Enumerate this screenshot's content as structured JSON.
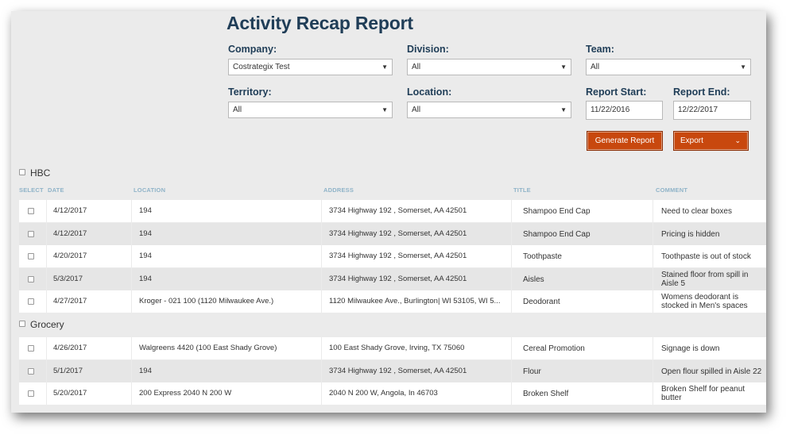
{
  "title": "Activity Recap Report",
  "filters": {
    "company": {
      "label": "Company:",
      "value": "Costrategix Test"
    },
    "division": {
      "label": "Division:",
      "value": "All"
    },
    "team": {
      "label": "Team:",
      "value": "All"
    },
    "territory": {
      "label": "Territory:",
      "value": "All"
    },
    "location": {
      "label": "Location:",
      "value": "All"
    },
    "report_start": {
      "label": "Report Start:",
      "value": "11/22/2016"
    },
    "report_end": {
      "label": "Report End:",
      "value": "12/22/2017"
    }
  },
  "buttons": {
    "generate": "Generate Report",
    "export": "Export"
  },
  "columns": {
    "select": "SELECT",
    "date": "DATE",
    "location": "LOCATION",
    "address": "ADDRESS",
    "title": "TITLE",
    "comment": "COMMENT"
  },
  "groups": [
    {
      "name": "HBC",
      "rows": [
        {
          "date": "4/12/2017",
          "location": "194",
          "address": "3734 Highway 192 , Somerset, AA 42501",
          "title": "Shampoo End Cap",
          "comment": "Need to clear boxes"
        },
        {
          "date": "4/12/2017",
          "location": "194",
          "address": "3734 Highway 192 , Somerset, AA 42501",
          "title": "Shampoo End Cap",
          "comment": "Pricing is hidden"
        },
        {
          "date": "4/20/2017",
          "location": "194",
          "address": "3734 Highway 192 , Somerset, AA 42501",
          "title": "Toothpaste",
          "comment": "Toothpaste is out of stock"
        },
        {
          "date": "5/3/2017",
          "location": "194",
          "address": "3734 Highway 192 , Somerset, AA 42501",
          "title": "Aisles",
          "comment": "Stained floor from spill in Aisle 5"
        },
        {
          "date": "4/27/2017",
          "location": "Kroger - 021 100 (1120 Milwaukee Ave.)",
          "address": "1120 Milwaukee Ave., Burlington| WI 53105, WI 5...",
          "title": "Deodorant",
          "comment": "Womens deodorant is stocked in Men's spaces"
        }
      ]
    },
    {
      "name": "Grocery",
      "rows": [
        {
          "date": "4/26/2017",
          "location": "Walgreens 4420 (100 East Shady Grove)",
          "address": "100 East Shady Grove, Irving, TX 75060",
          "title": "Cereal Promotion",
          "comment": "Signage is down"
        },
        {
          "date": "5/1/2017",
          "location": "194",
          "address": "3734 Highway 192 , Somerset, AA 42501",
          "title": "Flour",
          "comment": "Open flour spilled in Aisle 22"
        },
        {
          "date": "5/20/2017",
          "location": "200 Express 2040 N 200 W",
          "address": "2040 N 200 W, Angola, In 46703",
          "title": "Broken Shelf",
          "comment": "Broken Shelf for peanut butter"
        }
      ]
    }
  ]
}
